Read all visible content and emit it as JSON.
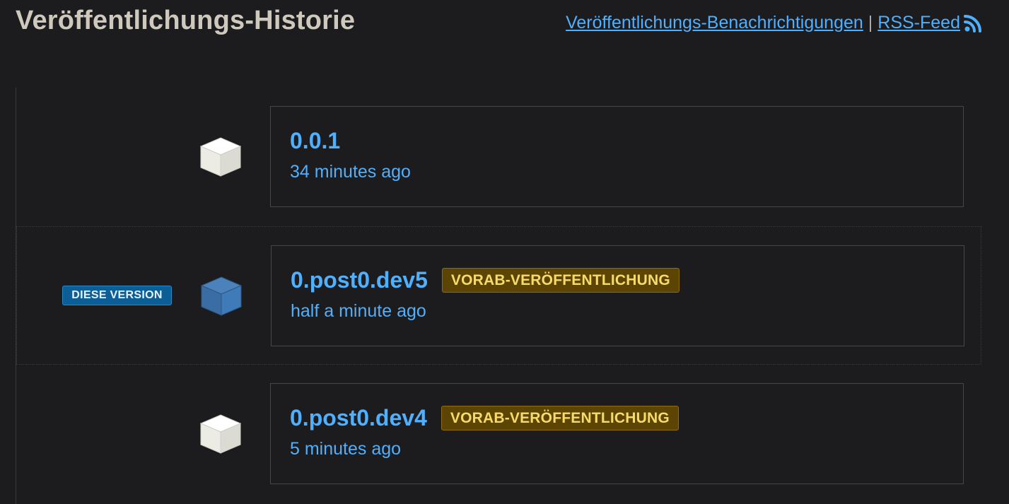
{
  "header": {
    "title": "Veröffentlichungs-Historie",
    "notifications_link": "Veröffentlichungs-Benachrichtigungen",
    "separator": "|",
    "rss_link": "RSS-Feed"
  },
  "this_version_badge": "DIESE VERSION",
  "releases": [
    {
      "version": "0.0.1",
      "time": "34 minutes ago",
      "badge": "",
      "current": false
    },
    {
      "version": "0.post0.dev5",
      "time": "half a minute ago",
      "badge": "VORAB-VERÖFFENTLICHUNG",
      "current": true
    },
    {
      "version": "0.post0.dev4",
      "time": "5 minutes ago",
      "badge": "VORAB-VERÖFFENTLICHUNG",
      "current": false
    }
  ],
  "colors": {
    "background": "#1c1c1e",
    "link": "#4fb0ff",
    "this_version_badge_bg": "#0b5f96",
    "prerelease_badge_bg": "#5c4503",
    "prerelease_badge_text": "#f7db6a",
    "cube_default": "#f0efe9",
    "cube_current": "#3f75ad"
  },
  "icons": {
    "rss": "rss-icon",
    "package": "package-cube-icon"
  }
}
